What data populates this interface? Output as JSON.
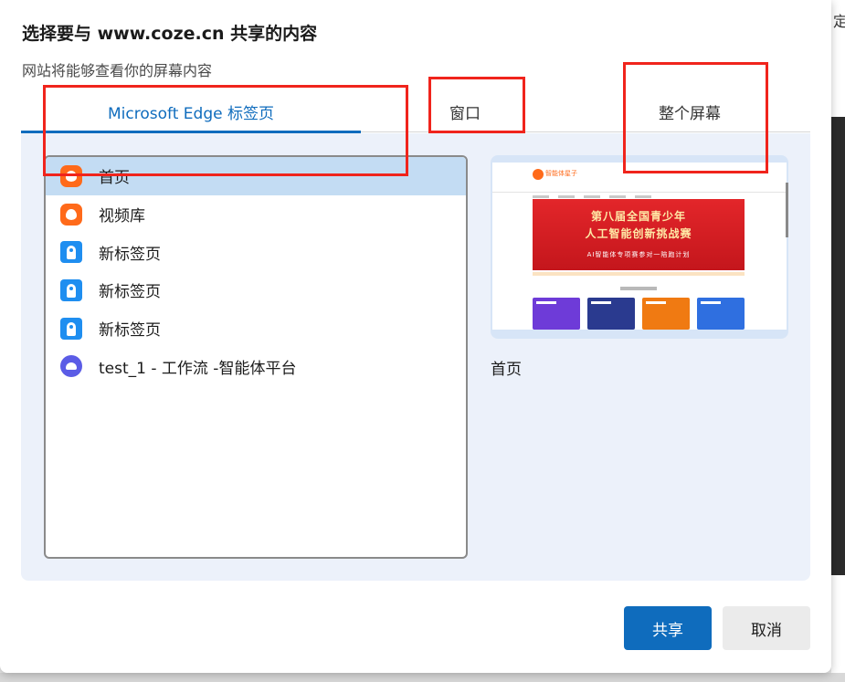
{
  "dialog": {
    "title": "选择要与 www.coze.cn 共享的内容",
    "subtitle": "网站将能够查看你的屏幕内容"
  },
  "tabs": [
    {
      "label": "Microsoft Edge 标签页",
      "active": true
    },
    {
      "label": "窗口",
      "active": false
    },
    {
      "label": "整个屏幕",
      "active": false
    }
  ],
  "list": {
    "items": [
      {
        "label": "首页",
        "icon": "coze-logo-icon",
        "selected": true
      },
      {
        "label": "视频库",
        "icon": "coze-logo-icon",
        "selected": false
      },
      {
        "label": "新标签页",
        "icon": "edge-new-tab-icon",
        "selected": false
      },
      {
        "label": "新标签页",
        "icon": "edge-new-tab-icon",
        "selected": false
      },
      {
        "label": "新标签页",
        "icon": "edge-new-tab-icon",
        "selected": false
      },
      {
        "label": "test_1 - 工作流 -智能体平台",
        "icon": "agent-platform-icon",
        "selected": false
      }
    ]
  },
  "preview": {
    "caption": "首页",
    "site_name": "智能体星子",
    "banner_line1": "第八届全国青少年",
    "banner_line2": "人工智能创新挑战赛",
    "banner_line3": "AI智能体专项赛参对一陪跑计划"
  },
  "buttons": {
    "share": "共享",
    "cancel": "取消"
  },
  "background": {
    "edge_text": "定"
  },
  "colors": {
    "accent": "#0f6cbd",
    "selected_row": "#c3dcf3",
    "panel": "#ecf1fa",
    "annotation": "#f0241c"
  }
}
